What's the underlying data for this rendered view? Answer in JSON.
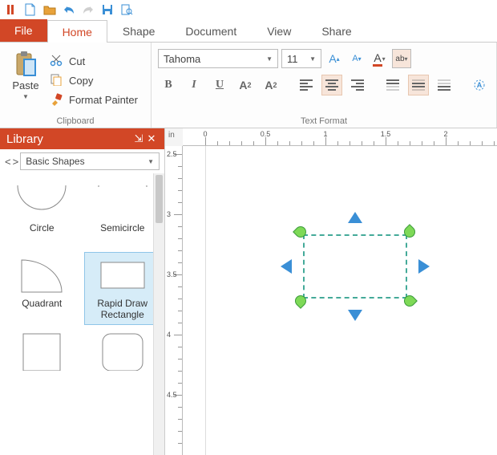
{
  "tabs": {
    "file": "File",
    "items": [
      "Home",
      "Shape",
      "Document",
      "View",
      "Share"
    ],
    "active": 0
  },
  "ribbon": {
    "clipboard": {
      "title": "Clipboard",
      "paste": "Paste",
      "cut": "Cut",
      "copy": "Copy",
      "format_painter": "Format Painter"
    },
    "textfmt": {
      "title": "Text Format",
      "font": "Tahoma",
      "size": "11",
      "bold": "B",
      "italic": "I",
      "underline": "U",
      "superscript": "A²",
      "subscript": "A₂"
    }
  },
  "library": {
    "title": "Library",
    "category": "Basic Shapes",
    "shapes": [
      {
        "label": "Circle"
      },
      {
        "label": "Semicircle"
      },
      {
        "label": "Quadrant"
      },
      {
        "label": "Rapid Draw Rectangle"
      },
      {
        "label": ""
      },
      {
        "label": ""
      }
    ],
    "selected": 3
  },
  "ruler": {
    "unit": "in",
    "h_labels": [
      "0",
      "0.5",
      "1",
      "1.5",
      "2"
    ],
    "v_labels": [
      "2.5",
      "3",
      "3.5",
      "4",
      "4.5"
    ]
  }
}
